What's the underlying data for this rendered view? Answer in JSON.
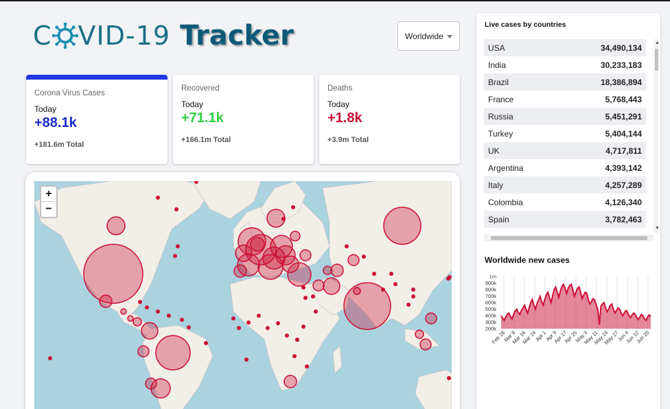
{
  "header": {
    "logo_covid_prefix": "C",
    "logo_covid_rest": "VID-19",
    "logo_tracker": "Tracker"
  },
  "filter": {
    "selected": "Worldwide"
  },
  "cards": [
    {
      "title": "Corona Virus Cases",
      "today_label": "Today",
      "today": "+88.1k",
      "total": "+181.6m Total",
      "color": "#1a2bc7"
    },
    {
      "title": "Recovered",
      "today_label": "Today",
      "today": "+71.1k",
      "total": "+166.1m Total",
      "color": "#2ecc40"
    },
    {
      "title": "Deaths",
      "today_label": "Today",
      "today": "+1.8k",
      "total": "+3.9m Total",
      "color": "#cc1034"
    }
  ],
  "map": {
    "zoom_in": "+",
    "zoom_out": "−",
    "circle_color": "#cc1034",
    "water_color": "#aad3df",
    "land_color": "#f2efe9"
  },
  "live_cases": {
    "title": "Live cases by countries",
    "rows": [
      {
        "country": "USA",
        "cases": "34,490,134"
      },
      {
        "country": "India",
        "cases": "30,233,183"
      },
      {
        "country": "Brazil",
        "cases": "18,386,894"
      },
      {
        "country": "France",
        "cases": "5,768,443"
      },
      {
        "country": "Russia",
        "cases": "5,451,291"
      },
      {
        "country": "Turkey",
        "cases": "5,404,144"
      },
      {
        "country": "UK",
        "cases": "4,717,811"
      },
      {
        "country": "Argentina",
        "cases": "4,393,142"
      },
      {
        "country": "Italy",
        "cases": "4,257,289"
      },
      {
        "country": "Colombia",
        "cases": "4,126,340"
      },
      {
        "country": "Spain",
        "cases": "3,782,463"
      }
    ]
  },
  "new_cases_chart": {
    "title": "Worldwide new cases"
  },
  "chart_data": {
    "type": "area",
    "title": "Worldwide new cases",
    "x_ticks": [
      "Feb 28",
      "Mar 8",
      "Mar 16",
      "Mar 24",
      "Apr 1",
      "Apr 9",
      "Apr 17",
      "Apr 25",
      "May 3",
      "May 11",
      "May 19",
      "May 27",
      "Jun 4",
      "Jun 12",
      "Jun 20"
    ],
    "y_ticks": [
      "1m",
      "900k",
      "800k",
      "700k",
      "600k",
      "500k",
      "400k",
      "300k",
      "200k"
    ],
    "ylim": [
      200000,
      1000000
    ],
    "grid": "vertical",
    "color": "#cc1034",
    "series": [
      {
        "values": [
          400000,
          360000,
          330000,
          380000,
          420000,
          440000,
          390000,
          350000,
          420000,
          470000,
          500000,
          450000,
          420000,
          480000,
          520000,
          560000,
          500000,
          440000,
          520000,
          600000,
          650000,
          560000,
          500000,
          580000,
          640000,
          700000,
          620000,
          560000,
          650000,
          720000,
          760000,
          680000,
          600000,
          700000,
          800000,
          840000,
          760000,
          680000,
          780000,
          850000,
          880000,
          820000,
          740000,
          820000,
          860000,
          880000,
          800000,
          700000,
          760000,
          820000,
          840000,
          760000,
          660000,
          720000,
          760000,
          740000,
          640000,
          580000,
          620000,
          660000,
          640000,
          560000,
          500000,
          260000,
          540000,
          580000,
          600000,
          520000,
          460000,
          500000,
          560000,
          580000,
          500000,
          440000,
          480000,
          520000,
          500000,
          440000,
          400000,
          440000,
          480000,
          460000,
          400000,
          370000,
          410000,
          440000,
          420000,
          370000,
          340000,
          380000,
          420000,
          400000,
          350000,
          330000,
          380000,
          410000,
          390000
        ]
      }
    ]
  }
}
